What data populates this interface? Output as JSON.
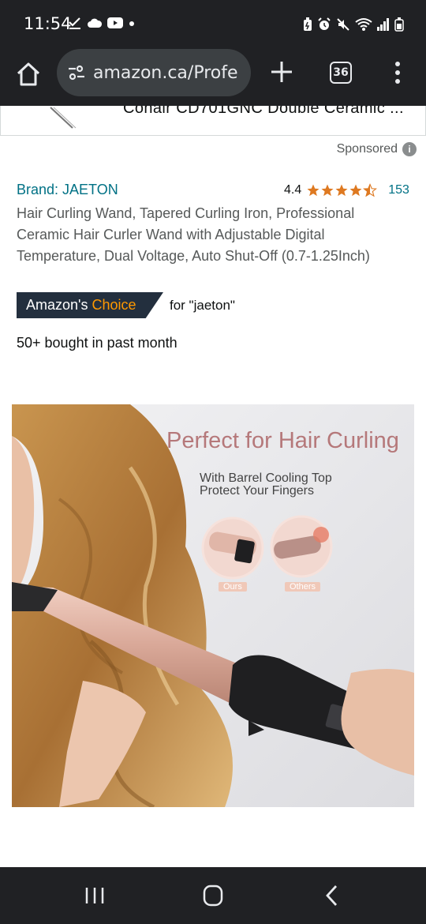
{
  "status": {
    "time": "11:54",
    "left_icons": [
      "check-download-icon",
      "cloud-icon",
      "youtube-icon",
      "dot-icon"
    ],
    "right_icons": [
      "battery-saver-icon",
      "alarm-icon",
      "mute-icon",
      "wifi-icon",
      "signal-icon",
      "battery-icon"
    ]
  },
  "browser": {
    "url": "amazon.ca/Profe",
    "tab_count": "36"
  },
  "previous_item": {
    "title": "Conair CD701GNC Double Ceramic ..."
  },
  "sponsored": {
    "label": "Sponsored"
  },
  "product": {
    "brand": "Brand: JAETON",
    "rating": "4.4",
    "rating_count": "153",
    "stars": 4.4,
    "title": "Hair Curling Wand, Tapered Curling Iron, Professional Ceramic Hair Curler Wand with Adjustable Digital Temperature, Dual Voltage, Auto Shut-Off (0.7-1.25Inch)",
    "choice_prefix": "Amazon's",
    "choice_word": "Choice",
    "choice_for": "for \"jaeton\"",
    "bought": "50+ bought in past month",
    "image": {
      "headline": "Perfect for Hair Curling",
      "sub_line1": "With Barrel Cooling Top",
      "sub_line2": "Protect Your Fingers",
      "label_ours": "Ours",
      "label_others": "Others"
    }
  },
  "colors": {
    "link": "#007185",
    "star": "#de7921",
    "choice_bg": "#232f3e",
    "choice_accent": "#ff9900",
    "chrome_bg": "#202124"
  }
}
